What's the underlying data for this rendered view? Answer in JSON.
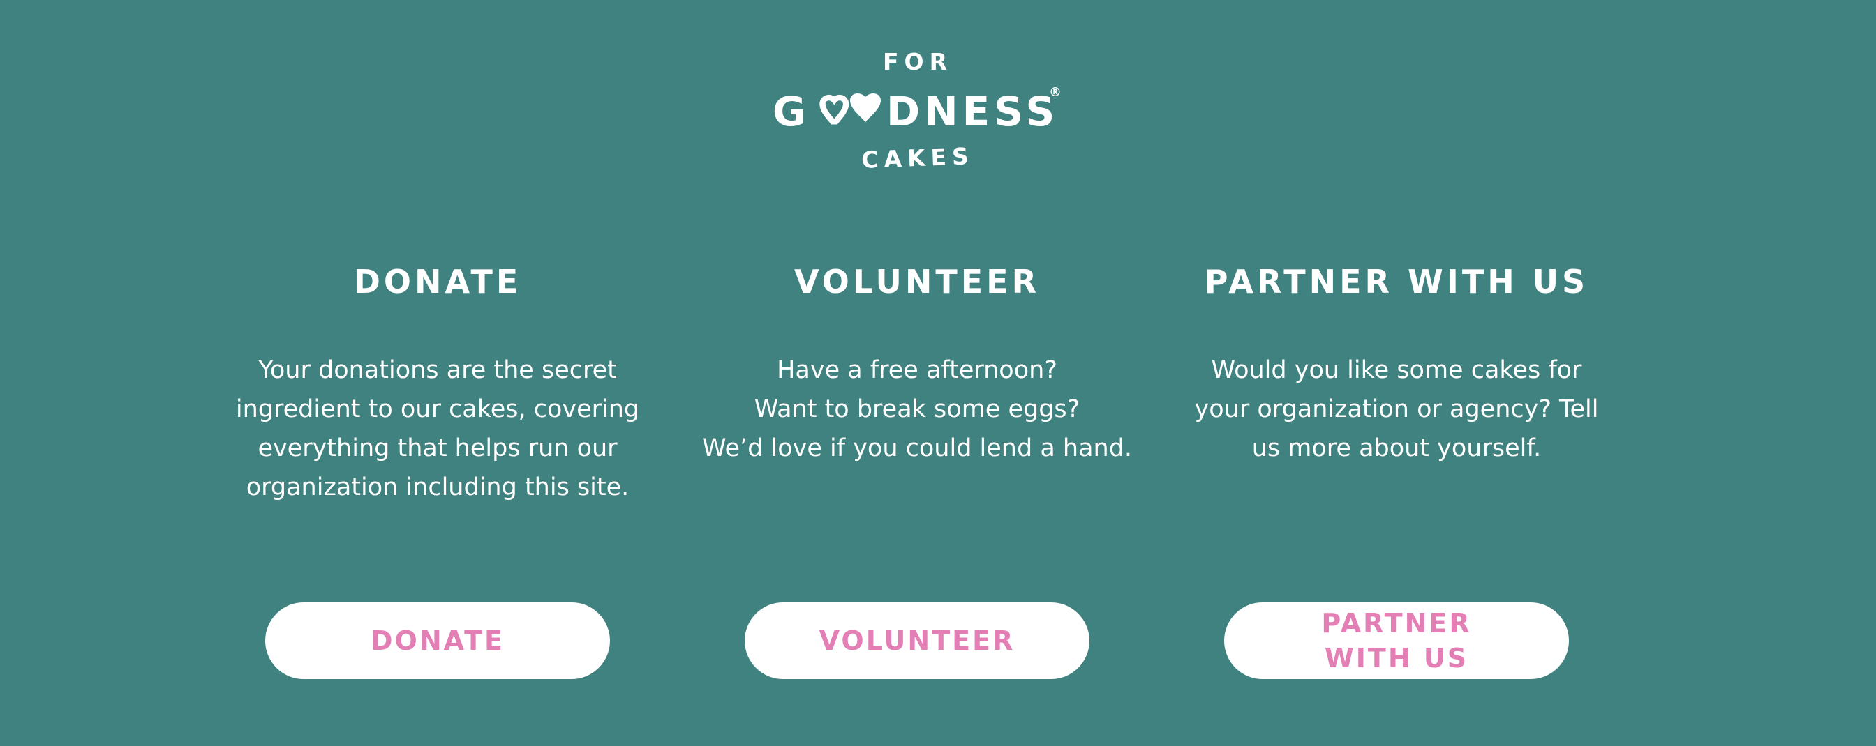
{
  "brand": {
    "top": "FOR",
    "middle": "GOODNESS",
    "bottom": "CAKES",
    "registered": "®"
  },
  "columns": [
    {
      "title": "DONATE",
      "body_lines": [
        "Your donations are the secret",
        "ingredient to our cakes, covering",
        "everything that helps run our",
        "organization including this site."
      ],
      "button_lines": [
        "DONATE"
      ]
    },
    {
      "title": "VOLUNTEER",
      "body_lines": [
        "Have a free afternoon?",
        "Want to break some eggs?",
        "We’d love if you could lend a hand."
      ],
      "button_lines": [
        "VOLUNTEER"
      ]
    },
    {
      "title": "PARTNER WITH US",
      "body_lines": [
        "Would you like some cakes for",
        "your organization or agency? Tell",
        "us more about yourself."
      ],
      "button_lines": [
        "PARTNER",
        "WITH US"
      ]
    }
  ],
  "colors": {
    "background": "#3f8280",
    "text": "#ffffff",
    "button_bg": "#ffffff",
    "button_text": "#e37fb5"
  }
}
